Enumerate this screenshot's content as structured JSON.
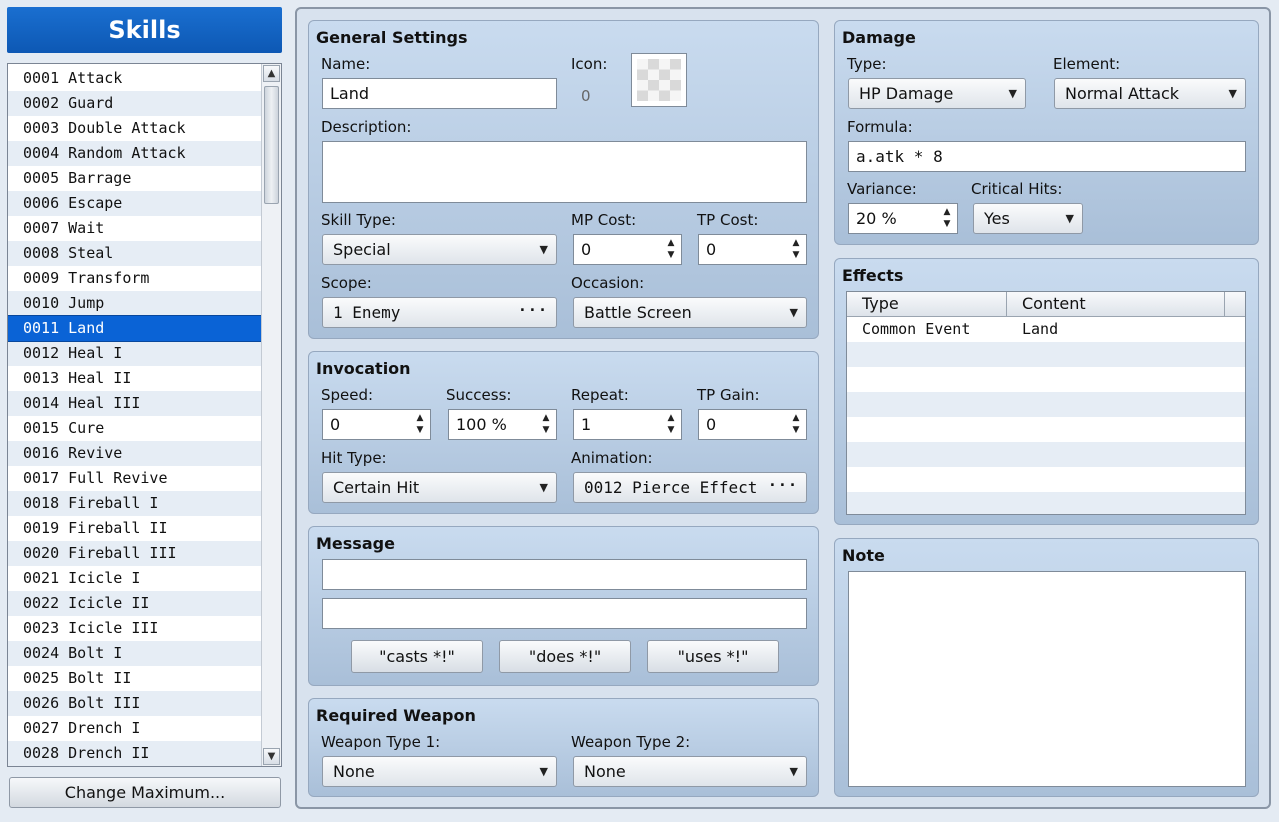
{
  "sidebar": {
    "title": "Skills",
    "items": [
      "0001 Attack",
      "0002 Guard",
      "0003 Double Attack",
      "0004 Random Attack",
      "0005 Barrage",
      "0006 Escape",
      "0007 Wait",
      "0008 Steal",
      "0009 Transform",
      "0010 Jump",
      "0011 Land",
      "0012 Heal I",
      "0013 Heal II",
      "0014 Heal III",
      "0015 Cure",
      "0016 Revive",
      "0017 Full Revive",
      "0018 Fireball I",
      "0019 Fireball II",
      "0020 Fireball III",
      "0021 Icicle I",
      "0022 Icicle II",
      "0023 Icicle III",
      "0024 Bolt I",
      "0025 Bolt II",
      "0026 Bolt III",
      "0027 Drench I",
      "0028 Drench II"
    ],
    "selected_index": 10,
    "change_max_label": "Change Maximum..."
  },
  "icons": {
    "scroll_up": "▲",
    "scroll_down": "▼",
    "dropdown": "▼",
    "spin": "▲▼",
    "ellipsis": "···"
  },
  "general": {
    "title": "General Settings",
    "name_label": "Name:",
    "name_value": "Land",
    "icon_label": "Icon:",
    "icon_index": "0",
    "description_label": "Description:",
    "description_value": "",
    "skill_type_label": "Skill Type:",
    "skill_type_value": "Special",
    "mp_cost_label": "MP Cost:",
    "mp_cost_value": "0",
    "tp_cost_label": "TP Cost:",
    "tp_cost_value": "0",
    "scope_label": "Scope:",
    "scope_value": "1 Enemy",
    "occasion_label": "Occasion:",
    "occasion_value": "Battle Screen"
  },
  "invocation": {
    "title": "Invocation",
    "speed_label": "Speed:",
    "speed_value": "0",
    "success_label": "Success:",
    "success_value": "100 %",
    "repeat_label": "Repeat:",
    "repeat_value": "1",
    "tp_gain_label": "TP Gain:",
    "tp_gain_value": "0",
    "hit_type_label": "Hit Type:",
    "hit_type_value": "Certain Hit",
    "animation_label": "Animation:",
    "animation_value": "0012 Pierce Effect"
  },
  "message": {
    "title": "Message",
    "line1": "",
    "line2": "",
    "casts_label": "\"casts *!\"",
    "does_label": "\"does *!\"",
    "uses_label": "\"uses *!\""
  },
  "required_weapon": {
    "title": "Required Weapon",
    "type1_label": "Weapon Type 1:",
    "type1_value": "None",
    "type2_label": "Weapon Type 2:",
    "type2_value": "None"
  },
  "damage": {
    "title": "Damage",
    "type_label": "Type:",
    "type_value": "HP Damage",
    "element_label": "Element:",
    "element_value": "Normal Attack",
    "formula_label": "Formula:",
    "formula_value": "a.atk * 8",
    "variance_label": "Variance:",
    "variance_value": "20 %",
    "critical_label": "Critical Hits:",
    "critical_value": "Yes"
  },
  "effects": {
    "title": "Effects",
    "columns": [
      "Type",
      "Content"
    ],
    "rows": [
      [
        "Common Event",
        "Land"
      ]
    ]
  },
  "note": {
    "title": "Note",
    "value": ""
  },
  "colors": {
    "selection": "#0a63d6",
    "header": "#1a6fd0"
  }
}
